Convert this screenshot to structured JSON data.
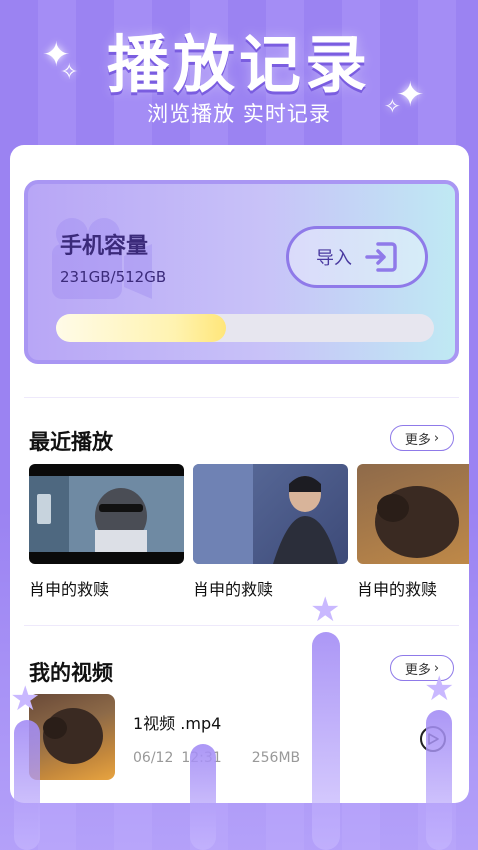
{
  "header": {
    "title": "播放记录",
    "subtitle": "浏览播放 实时记录"
  },
  "storage": {
    "title": "手机容量",
    "size": "231GB/512GB",
    "import_label": "导入",
    "usage_fraction": 0.45
  },
  "recent": {
    "title": "最近播放",
    "more_label": "更多",
    "items": [
      {
        "label": "肖申的救赎"
      },
      {
        "label": "肖申的救赎"
      },
      {
        "label": "肖申的救赎"
      }
    ]
  },
  "my_videos": {
    "title": "我的视频",
    "more_label": "更多",
    "items": [
      {
        "name": "1视频 .mp4",
        "date": "06/12",
        "time": "12:31",
        "size": "256MB"
      }
    ]
  },
  "colors": {
    "accent": "#8f7ae9",
    "background": "#9b83f2"
  }
}
